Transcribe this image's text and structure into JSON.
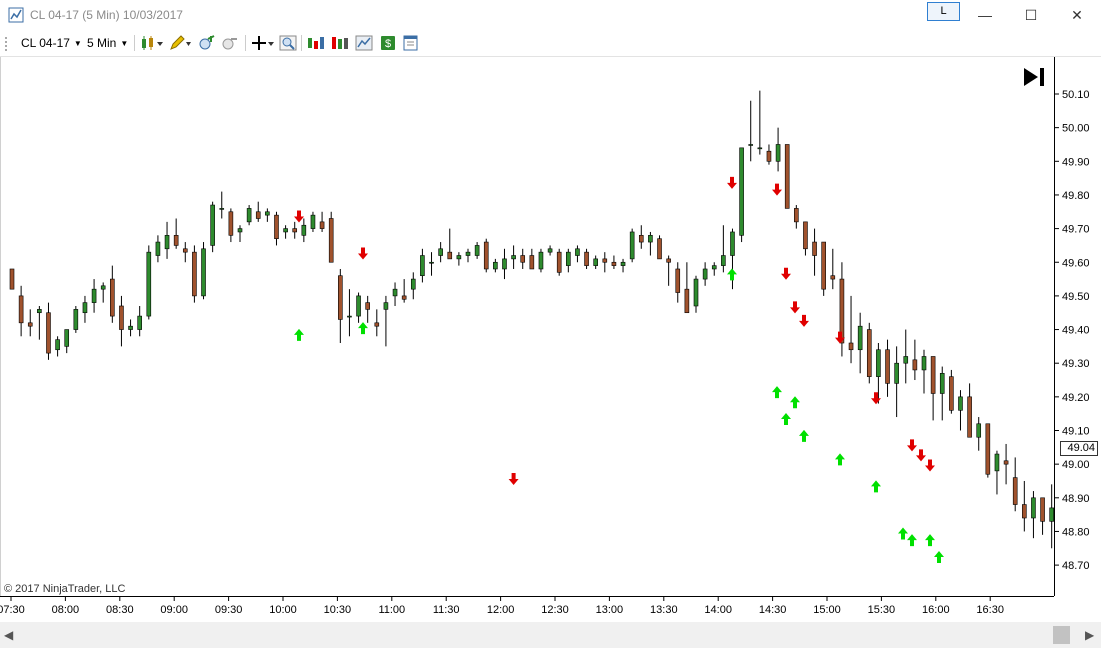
{
  "window": {
    "title": "CL 04-17 (5 Min)  10/03/2017",
    "link_button": "L",
    "minimize_icon": "minimize-icon",
    "maximize_icon": "maximize-icon",
    "close_icon": "close-icon"
  },
  "toolbar": {
    "instrument": "CL 04-17",
    "interval": "5 Min",
    "icons": [
      "bar-type-icon",
      "drawing-tool-icon",
      "zoom-in-icon",
      "zoom-out-icon",
      "crosshair-icon",
      "magnifier-icon",
      "indicators-icon",
      "strategies-icon",
      "chart-style-icon",
      "dollar-icon",
      "properties-icon"
    ]
  },
  "colors": {
    "up_candle": "#2e8b2e",
    "down_candle": "#a0522d",
    "arrow_up": "#00e000",
    "arrow_down": "#e00000"
  },
  "chart": {
    "copyright": "© 2017 NinjaTrader, LLC",
    "current_price": "49.04",
    "go_to_end_icon": "skip-to-end-icon"
  },
  "chart_data": {
    "type": "candlestick",
    "y_ticks": [
      "50.10",
      "50.00",
      "49.90",
      "49.80",
      "49.70",
      "49.60",
      "49.50",
      "49.40",
      "49.30",
      "49.20",
      "49.10",
      "49.00",
      "48.90",
      "48.80",
      "48.70"
    ],
    "ylim": [
      48.6,
      50.2
    ],
    "x_ticks": [
      "07:30",
      "08:00",
      "08:30",
      "09:00",
      "09:30",
      "10:00",
      "10:30",
      "11:00",
      "11:30",
      "12:00",
      "12:30",
      "13:00",
      "13:30",
      "14:00",
      "14:30",
      "15:00",
      "15:30",
      "16:00",
      "16:30"
    ],
    "candles": [
      [
        49.58,
        49.52,
        49.58,
        49.52
      ],
      [
        49.5,
        49.53,
        49.38,
        49.42
      ],
      [
        49.42,
        49.46,
        49.38,
        49.41
      ],
      [
        49.45,
        49.47,
        49.37,
        49.46
      ],
      [
        49.45,
        49.48,
        49.31,
        49.33
      ],
      [
        49.34,
        49.38,
        49.32,
        49.37
      ],
      [
        49.35,
        49.4,
        49.33,
        49.4
      ],
      [
        49.4,
        49.47,
        49.39,
        49.46
      ],
      [
        49.45,
        49.5,
        49.42,
        49.48
      ],
      [
        49.48,
        49.55,
        49.45,
        49.52
      ],
      [
        49.52,
        49.54,
        49.48,
        49.53
      ],
      [
        49.55,
        49.59,
        49.42,
        49.44
      ],
      [
        49.47,
        49.5,
        49.35,
        49.4
      ],
      [
        49.4,
        49.43,
        49.38,
        49.41
      ],
      [
        49.4,
        49.47,
        49.38,
        49.44
      ],
      [
        49.44,
        49.65,
        49.43,
        49.63
      ],
      [
        49.62,
        49.68,
        49.6,
        49.66
      ],
      [
        49.64,
        49.72,
        49.61,
        49.68
      ],
      [
        49.68,
        49.73,
        49.64,
        49.65
      ],
      [
        49.64,
        49.66,
        49.6,
        49.63
      ],
      [
        49.63,
        49.65,
        49.48,
        49.5
      ],
      [
        49.5,
        49.66,
        49.49,
        49.64
      ],
      [
        49.65,
        49.78,
        49.63,
        49.77
      ],
      [
        49.76,
        49.81,
        49.73,
        49.76
      ],
      [
        49.75,
        49.76,
        49.66,
        49.68
      ],
      [
        49.69,
        49.71,
        49.66,
        49.7
      ],
      [
        49.72,
        49.77,
        49.71,
        49.76
      ],
      [
        49.75,
        49.78,
        49.72,
        49.73
      ],
      [
        49.74,
        49.76,
        49.72,
        49.75
      ],
      [
        49.74,
        49.75,
        49.65,
        49.67
      ],
      [
        49.69,
        49.71,
        49.67,
        49.7
      ],
      [
        49.7,
        49.72,
        49.67,
        49.69
      ],
      [
        49.68,
        49.73,
        49.66,
        49.71
      ],
      [
        49.7,
        49.75,
        49.69,
        49.74
      ],
      [
        49.72,
        49.75,
        49.69,
        49.7
      ],
      [
        49.73,
        49.75,
        49.6,
        49.6
      ],
      [
        49.56,
        49.58,
        49.36,
        49.43
      ],
      [
        49.44,
        49.52,
        49.38,
        49.44
      ],
      [
        49.44,
        49.51,
        49.42,
        49.5
      ],
      [
        49.48,
        49.5,
        49.42,
        49.46
      ],
      [
        49.42,
        49.46,
        49.38,
        49.41
      ],
      [
        49.46,
        49.5,
        49.35,
        49.48
      ],
      [
        49.5,
        49.54,
        49.47,
        49.52
      ],
      [
        49.5,
        49.55,
        49.48,
        49.49
      ],
      [
        49.52,
        49.57,
        49.49,
        49.55
      ],
      [
        49.56,
        49.64,
        49.54,
        49.62
      ],
      [
        49.6,
        49.63,
        49.56,
        49.6
      ],
      [
        49.62,
        49.66,
        49.6,
        49.64
      ],
      [
        49.63,
        49.7,
        49.61,
        49.61
      ],
      [
        49.61,
        49.63,
        49.59,
        49.62
      ],
      [
        49.62,
        49.64,
        49.6,
        49.63
      ],
      [
        49.62,
        49.66,
        49.61,
        49.65
      ],
      [
        49.66,
        49.67,
        49.57,
        49.58
      ],
      [
        49.58,
        49.61,
        49.57,
        49.6
      ],
      [
        49.58,
        49.64,
        49.55,
        49.61
      ],
      [
        49.61,
        49.65,
        49.58,
        49.62
      ],
      [
        49.62,
        49.64,
        49.58,
        49.6
      ],
      [
        49.62,
        49.64,
        49.58,
        49.58
      ],
      [
        49.58,
        49.64,
        49.57,
        49.63
      ],
      [
        49.63,
        49.65,
        49.62,
        49.64
      ],
      [
        49.63,
        49.64,
        49.56,
        49.57
      ],
      [
        49.59,
        49.64,
        49.57,
        49.63
      ],
      [
        49.62,
        49.65,
        49.6,
        49.64
      ],
      [
        49.63,
        49.64,
        49.58,
        49.59
      ],
      [
        49.59,
        49.62,
        49.58,
        49.61
      ],
      [
        49.61,
        49.63,
        49.57,
        49.6
      ],
      [
        49.6,
        49.62,
        49.58,
        49.59
      ],
      [
        49.59,
        49.61,
        49.57,
        49.6
      ],
      [
        49.61,
        49.7,
        49.6,
        49.69
      ],
      [
        49.68,
        49.71,
        49.64,
        49.66
      ],
      [
        49.66,
        49.69,
        49.62,
        49.68
      ],
      [
        49.67,
        49.68,
        49.61,
        49.61
      ],
      [
        49.61,
        49.62,
        49.53,
        49.6
      ],
      [
        49.58,
        49.6,
        49.48,
        49.51
      ],
      [
        49.52,
        49.6,
        49.45,
        49.45
      ],
      [
        49.47,
        49.56,
        49.45,
        49.55
      ],
      [
        49.55,
        49.6,
        49.53,
        49.58
      ],
      [
        49.58,
        49.6,
        49.56,
        49.59
      ],
      [
        49.59,
        49.71,
        49.57,
        49.62
      ],
      [
        49.62,
        49.7,
        49.52,
        49.69
      ],
      [
        49.68,
        49.94,
        49.66,
        49.94
      ],
      [
        49.95,
        50.08,
        49.9,
        49.95
      ],
      [
        49.94,
        50.11,
        49.92,
        49.94
      ],
      [
        49.93,
        49.95,
        49.89,
        49.9
      ],
      [
        49.9,
        50.0,
        49.87,
        49.95
      ],
      [
        49.95,
        49.95,
        49.76,
        49.76
      ],
      [
        49.76,
        49.77,
        49.7,
        49.72
      ],
      [
        49.72,
        49.72,
        49.62,
        49.64
      ],
      [
        49.66,
        49.7,
        49.56,
        49.62
      ],
      [
        49.66,
        49.66,
        49.5,
        49.52
      ],
      [
        49.56,
        49.64,
        49.52,
        49.55
      ],
      [
        49.55,
        49.6,
        49.32,
        49.36
      ],
      [
        49.36,
        49.5,
        49.3,
        49.34
      ],
      [
        49.34,
        49.45,
        49.27,
        49.41
      ],
      [
        49.4,
        49.42,
        49.24,
        49.26
      ],
      [
        49.26,
        49.36,
        49.18,
        49.34
      ],
      [
        49.34,
        49.37,
        49.2,
        49.24
      ],
      [
        49.24,
        49.35,
        49.14,
        49.3
      ],
      [
        49.3,
        49.4,
        49.24,
        49.32
      ],
      [
        49.31,
        49.37,
        49.25,
        49.28
      ],
      [
        49.28,
        49.34,
        49.21,
        49.32
      ],
      [
        49.32,
        49.32,
        49.13,
        49.21
      ],
      [
        49.21,
        49.29,
        49.13,
        49.27
      ],
      [
        49.26,
        49.28,
        49.15,
        49.16
      ],
      [
        49.16,
        49.22,
        49.1,
        49.2
      ],
      [
        49.2,
        49.24,
        49.08,
        49.08
      ],
      [
        49.08,
        49.14,
        49.04,
        49.12
      ],
      [
        49.12,
        49.12,
        48.96,
        48.97
      ],
      [
        48.98,
        49.04,
        48.91,
        49.03
      ],
      [
        49.01,
        49.06,
        48.94,
        49.0
      ],
      [
        48.96,
        49.02,
        48.86,
        48.88
      ],
      [
        48.88,
        48.95,
        48.8,
        48.84
      ],
      [
        48.84,
        48.92,
        48.78,
        48.9
      ],
      [
        48.9,
        48.9,
        48.79,
        48.83
      ],
      [
        48.83,
        48.94,
        48.75,
        48.87
      ],
      [
        48.87,
        48.9,
        48.79,
        48.8
      ],
      [
        48.8,
        48.82,
        48.72,
        48.8
      ],
      [
        48.8,
        48.84,
        48.77,
        48.83
      ],
      [
        48.84,
        48.86,
        48.79,
        48.84
      ],
      [
        48.82,
        48.84,
        48.8,
        48.81
      ],
      [
        48.82,
        48.95,
        48.8,
        48.94
      ],
      [
        48.94,
        49.1,
        48.93,
        49.1
      ],
      [
        49.08,
        49.1,
        48.94,
        49.01
      ],
      [
        48.99,
        49.09,
        48.96,
        49.08
      ],
      [
        49.07,
        49.1,
        49.03,
        49.04
      ]
    ],
    "sell_arrows": [
      [
        9,
        49.73
      ],
      [
        13,
        49.62
      ],
      [
        31,
        49.83
      ],
      [
        34,
        49.81
      ],
      [
        37,
        49.56
      ],
      [
        38,
        49.46
      ],
      [
        39,
        49.42
      ],
      [
        41,
        49.37
      ],
      [
        45,
        49.19
      ],
      [
        49,
        49.05
      ],
      [
        53,
        49.02
      ],
      [
        54,
        48.99
      ],
      [
        55,
        48.95
      ]
    ],
    "buy_arrows": [
      [
        9,
        49.39
      ],
      [
        13,
        49.41
      ],
      [
        31,
        49.57
      ],
      [
        34,
        49.22
      ],
      [
        37,
        49.14
      ],
      [
        38,
        49.19
      ],
      [
        39,
        49.09
      ],
      [
        41,
        49.02
      ],
      [
        45,
        48.94
      ],
      [
        49,
        48.8
      ],
      [
        51,
        48.78
      ],
      [
        53,
        48.78
      ],
      [
        54,
        48.73
      ]
    ]
  }
}
